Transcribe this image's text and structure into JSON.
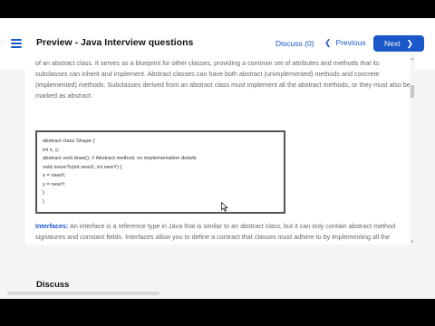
{
  "header": {
    "title": "Preview - Java Interview questions",
    "discuss_label": "Discuss (0)",
    "prev_label": "Previous",
    "next_label": "Next"
  },
  "content": {
    "paragraph_top": "of an abstract class. It serves as a blueprint for other classes, providing a common set of attributes and methods that its subclasses can inherit and implement. Abstract classes can have both abstract (unimplemented) methods and concrete (implemented) methods. Subclasses derived from an abstract class must implement all the abstract methods, or they must also be marked as abstract.",
    "code_lines": [
      "abstract class Shape {",
      "int x, y;",
      "abstract void draw(); // Abstract method, no implementation details",
      "void moveTo(int newX, int newY) {",
      "x = newX;",
      "y = newY;",
      "}",
      "}"
    ],
    "interfaces_term": "Interfaces:",
    "interfaces_text": " An interface is a reference type in Java that is similar to an abstract class, but it can only contain abstract method signatures and constant fields. Interfaces allow you to define a contract that classes must adhere to by implementing all the methods declared in the interface. A class can implement multiple interfaces, enabling multiple inheritance of behavior."
  },
  "discuss_section": {
    "heading": "Discuss"
  },
  "colors": {
    "accent": "#1a57c8",
    "page_bg": "#f4f5f7"
  },
  "icons": {
    "menu": "hamburger-icon",
    "prev": "chevron-left-icon",
    "next": "chevron-right-icon",
    "cursor": "mouse-pointer-icon"
  }
}
